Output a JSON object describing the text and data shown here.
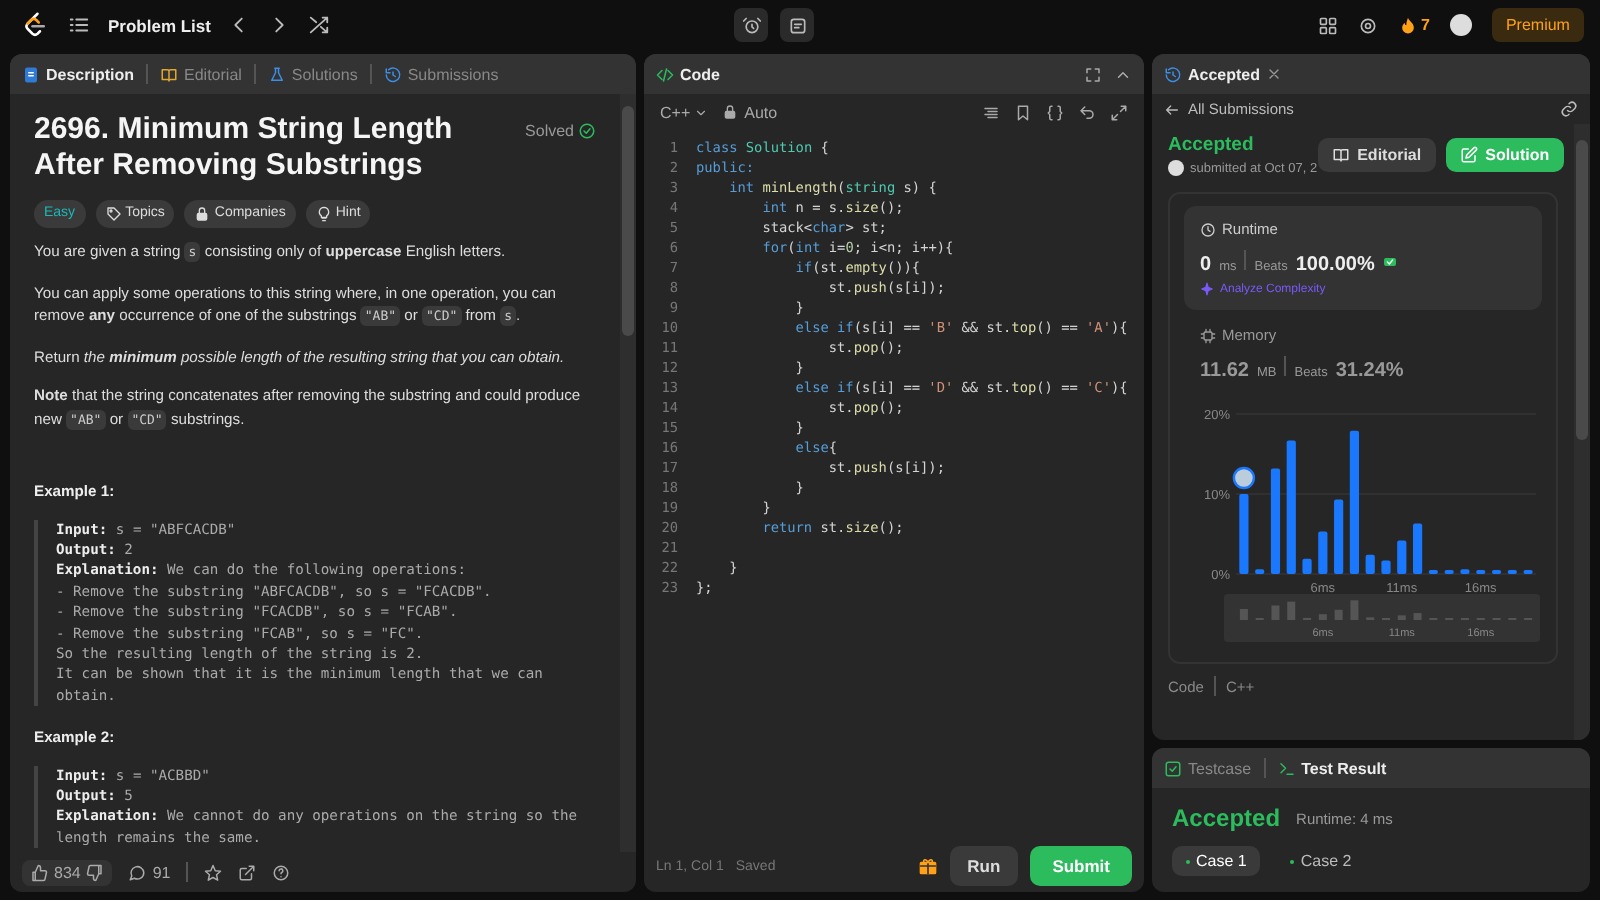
{
  "top_bar": {
    "nav_title": "Problem List",
    "streak_count": "7",
    "premium_label": "Premium"
  },
  "description_panel": {
    "tabs": [
      {
        "label": "Description",
        "selected": true,
        "kind": "description"
      },
      {
        "label": "Editorial",
        "selected": false,
        "kind": "editorial"
      },
      {
        "label": "Solutions",
        "selected": false,
        "kind": "solutions"
      },
      {
        "label": "Submissions",
        "selected": false,
        "kind": "submissions"
      }
    ],
    "title": "2696. Minimum String Length After Removing Substrings",
    "status": "Solved",
    "tags": [
      {
        "label": "Easy",
        "kind": "difficulty"
      },
      {
        "label": "Topics",
        "kind": "topics"
      },
      {
        "label": "Companies",
        "kind": "companies"
      },
      {
        "label": "Hint",
        "kind": "hint"
      }
    ],
    "paragraphs": [
      [
        {
          "kind": "text",
          "text": "You are given a string "
        },
        {
          "kind": "code",
          "text": "s"
        },
        {
          "kind": "text",
          "text": " consisting only of **uppercase** English letters."
        }
      ],
      [
        {
          "kind": "text",
          "text": "You can apply some operations to this string where, in one operation, you can remove **any** occurrence of one of the substrings "
        },
        {
          "kind": "code",
          "text": "\"AB\""
        },
        {
          "kind": "text",
          "text": " or "
        },
        {
          "kind": "code",
          "text": "\"CD\""
        },
        {
          "kind": "text",
          "text": " from "
        },
        {
          "kind": "code",
          "text": "s"
        },
        {
          "kind": "text",
          "text": "."
        }
      ],
      [
        {
          "kind": "text",
          "text": "Return "
        },
        {
          "kind": "em",
          "text": "the **minimum** possible length of the resulting string that you can obtain."
        }
      ],
      [
        {
          "kind": "text",
          "text": "**Note** that the string concatenates after removing the substring and could produce new "
        },
        {
          "kind": "code",
          "text": "\"AB\""
        },
        {
          "kind": "text",
          "text": " or "
        },
        {
          "kind": "code",
          "text": "\"CD\""
        },
        {
          "kind": "text",
          "text": " substrings."
        }
      ]
    ],
    "examples": [
      {
        "heading": "Example 1:",
        "lines": [
          {
            "label": "Input:",
            "text": "s = \"ABFCACDB\""
          },
          {
            "label": "Output:",
            "text": "2"
          },
          {
            "label": "Explanation:",
            "text": "We can do the following operations:"
          },
          {
            "text": "- Remove the substring \"ABFCACDB\", so s = \"FCACDB\"."
          },
          {
            "text": "- Remove the substring \"FCACDB\", so s = \"FCAB\"."
          },
          {
            "text": "- Remove the substring \"FCAB\", so s = \"FC\"."
          },
          {
            "text": "So the resulting length of the string is 2."
          },
          {
            "text": "It can be shown that it is the minimum length that we can obtain."
          }
        ]
      },
      {
        "heading": "Example 2:",
        "lines": [
          {
            "label": "Input:",
            "text": "s = \"ACBBD\""
          },
          {
            "label": "Output:",
            "text": "5"
          },
          {
            "label": "Explanation:",
            "text": "We cannot do any operations on the string so the length remains the same."
          }
        ]
      }
    ],
    "footer": {
      "likes": "834",
      "comments": "91"
    }
  },
  "code_panel": {
    "title": "Code",
    "language": "C++",
    "mode": "Auto",
    "lines": [
      {
        "number": "1",
        "tokens": [
          {
            "kind": "keyword",
            "text": "class "
          },
          {
            "kind": "type",
            "text": "Solution"
          },
          {
            "kind": "plain",
            "text": " {"
          }
        ]
      },
      {
        "number": "2",
        "tokens": [
          {
            "kind": "keyword",
            "text": "public:"
          }
        ]
      },
      {
        "number": "3",
        "tokens": [
          {
            "kind": "keyword",
            "text": "    int "
          },
          {
            "kind": "function",
            "text": "minLength"
          },
          {
            "kind": "plain",
            "text": "("
          },
          {
            "kind": "type",
            "text": "string"
          },
          {
            "kind": "plain",
            "text": " s) {"
          }
        ]
      },
      {
        "number": "4",
        "tokens": [
          {
            "kind": "keyword",
            "text": "        int "
          },
          {
            "kind": "plain",
            "text": "n = s."
          },
          {
            "kind": "function",
            "text": "size"
          },
          {
            "kind": "plain",
            "text": "();"
          }
        ]
      },
      {
        "number": "5",
        "tokens": [
          {
            "kind": "plain",
            "text": "        stack<"
          },
          {
            "kind": "keyword",
            "text": "char"
          },
          {
            "kind": "plain",
            "text": "> st;"
          }
        ]
      },
      {
        "number": "6",
        "tokens": [
          {
            "kind": "keyword",
            "text": "        for"
          },
          {
            "kind": "plain",
            "text": "("
          },
          {
            "kind": "keyword",
            "text": "int "
          },
          {
            "kind": "plain",
            "text": "i="
          },
          {
            "kind": "number",
            "text": "0"
          },
          {
            "kind": "plain",
            "text": "; i<n; i++){"
          }
        ]
      },
      {
        "number": "7",
        "tokens": [
          {
            "kind": "keyword",
            "text": "            if"
          },
          {
            "kind": "plain",
            "text": "(st."
          },
          {
            "kind": "function",
            "text": "empty"
          },
          {
            "kind": "plain",
            "text": "()){"
          }
        ]
      },
      {
        "number": "8",
        "tokens": [
          {
            "kind": "plain",
            "text": "                st."
          },
          {
            "kind": "function",
            "text": "push"
          },
          {
            "kind": "plain",
            "text": "(s[i]);"
          }
        ]
      },
      {
        "number": "9",
        "tokens": [
          {
            "kind": "plain",
            "text": "            }"
          }
        ]
      },
      {
        "number": "10",
        "tokens": [
          {
            "kind": "keyword",
            "text": "            else if"
          },
          {
            "kind": "plain",
            "text": "(s[i] == "
          },
          {
            "kind": "string",
            "text": "'B'"
          },
          {
            "kind": "plain",
            "text": " && st."
          },
          {
            "kind": "function",
            "text": "top"
          },
          {
            "kind": "plain",
            "text": "() == "
          },
          {
            "kind": "string",
            "text": "'A'"
          },
          {
            "kind": "plain",
            "text": "){"
          }
        ]
      },
      {
        "number": "11",
        "tokens": [
          {
            "kind": "plain",
            "text": "                st."
          },
          {
            "kind": "function",
            "text": "pop"
          },
          {
            "kind": "plain",
            "text": "();"
          }
        ]
      },
      {
        "number": "12",
        "tokens": [
          {
            "kind": "plain",
            "text": "            }"
          }
        ]
      },
      {
        "number": "13",
        "tokens": [
          {
            "kind": "keyword",
            "text": "            else if"
          },
          {
            "kind": "plain",
            "text": "(s[i] == "
          },
          {
            "kind": "string",
            "text": "'D'"
          },
          {
            "kind": "plain",
            "text": " && st."
          },
          {
            "kind": "function",
            "text": "top"
          },
          {
            "kind": "plain",
            "text": "() == "
          },
          {
            "kind": "string",
            "text": "'C'"
          },
          {
            "kind": "plain",
            "text": "){"
          }
        ]
      },
      {
        "number": "14",
        "tokens": [
          {
            "kind": "plain",
            "text": "                st."
          },
          {
            "kind": "function",
            "text": "pop"
          },
          {
            "kind": "plain",
            "text": "();"
          }
        ]
      },
      {
        "number": "15",
        "tokens": [
          {
            "kind": "plain",
            "text": "            }"
          }
        ]
      },
      {
        "number": "16",
        "tokens": [
          {
            "kind": "keyword",
            "text": "            else"
          },
          {
            "kind": "plain",
            "text": "{"
          }
        ]
      },
      {
        "number": "17",
        "tokens": [
          {
            "kind": "plain",
            "text": "                st."
          },
          {
            "kind": "function",
            "text": "push"
          },
          {
            "kind": "plain",
            "text": "(s[i]);"
          }
        ]
      },
      {
        "number": "18",
        "tokens": [
          {
            "kind": "plain",
            "text": "            }"
          }
        ]
      },
      {
        "number": "19",
        "tokens": [
          {
            "kind": "plain",
            "text": "        }"
          }
        ]
      },
      {
        "number": "20",
        "tokens": [
          {
            "kind": "keyword",
            "text": "        return "
          },
          {
            "kind": "plain",
            "text": "st."
          },
          {
            "kind": "function",
            "text": "size"
          },
          {
            "kind": "plain",
            "text": "();"
          }
        ]
      },
      {
        "number": "21"
      },
      {
        "number": "22",
        "tokens": [
          {
            "kind": "plain",
            "text": "    }"
          }
        ]
      },
      {
        "number": "23",
        "tokens": [
          {
            "kind": "plain",
            "text": "};"
          }
        ]
      }
    ],
    "cursor": "Ln 1, Col 1",
    "save_status": "Saved",
    "run_label": "Run",
    "submit_label": "Submit"
  },
  "result_panel": {
    "tab": "Accepted",
    "back_label": "All Submissions",
    "status": "Accepted",
    "submitted": "submitted at Oct 07, 2",
    "editorial_label": "Editorial",
    "solution_label": "Solution",
    "runtime": {
      "label": "Runtime",
      "value": "0",
      "unit": "ms",
      "beats_label": "Beats",
      "beats": "100.00%",
      "analyze_label": "Analyze Complexity"
    },
    "memory": {
      "label": "Memory",
      "value": "11.62",
      "unit": "MB",
      "beats_label": "Beats",
      "beats": "31.24%"
    },
    "chart_data": {
      "type": "bar",
      "x": [
        1,
        2,
        3,
        4,
        5,
        6,
        7,
        8,
        9,
        10,
        11,
        12,
        13,
        14,
        15,
        16,
        17,
        18,
        19
      ],
      "values": [
        10,
        0.6,
        13.2,
        16.7,
        1.9,
        5.3,
        9.3,
        17.9,
        2.4,
        1.7,
        4.2,
        6.3,
        0.5,
        0.5,
        0.6,
        0.5,
        0.5,
        0.5,
        0.5
      ],
      "xlim": [
        0.5,
        19.5
      ],
      "ylim": [
        0,
        20
      ],
      "yticks": [
        {
          "value": 0,
          "label": "0%"
        },
        {
          "value": 10,
          "label": "10%"
        },
        {
          "value": 20,
          "label": "20%"
        }
      ],
      "xticks": [
        {
          "value": 6,
          "label": "6ms"
        },
        {
          "value": 11,
          "label": "11ms"
        },
        {
          "value": 16,
          "label": "16ms"
        }
      ]
    },
    "navigator_labels": [
      "6ms",
      "11ms",
      "16ms"
    ],
    "code_label": "Code",
    "code_language": "C++"
  },
  "test_panel": {
    "tabs": [
      {
        "label": "Testcase",
        "selected": false,
        "kind": "testcase"
      },
      {
        "label": "Test Result",
        "selected": true,
        "kind": "result"
      }
    ],
    "status": "Accepted",
    "runtime": "Runtime: 4 ms",
    "cases": [
      {
        "label": "Case 1",
        "selected": true
      },
      {
        "label": "Case 2",
        "selected": false
      }
    ]
  }
}
